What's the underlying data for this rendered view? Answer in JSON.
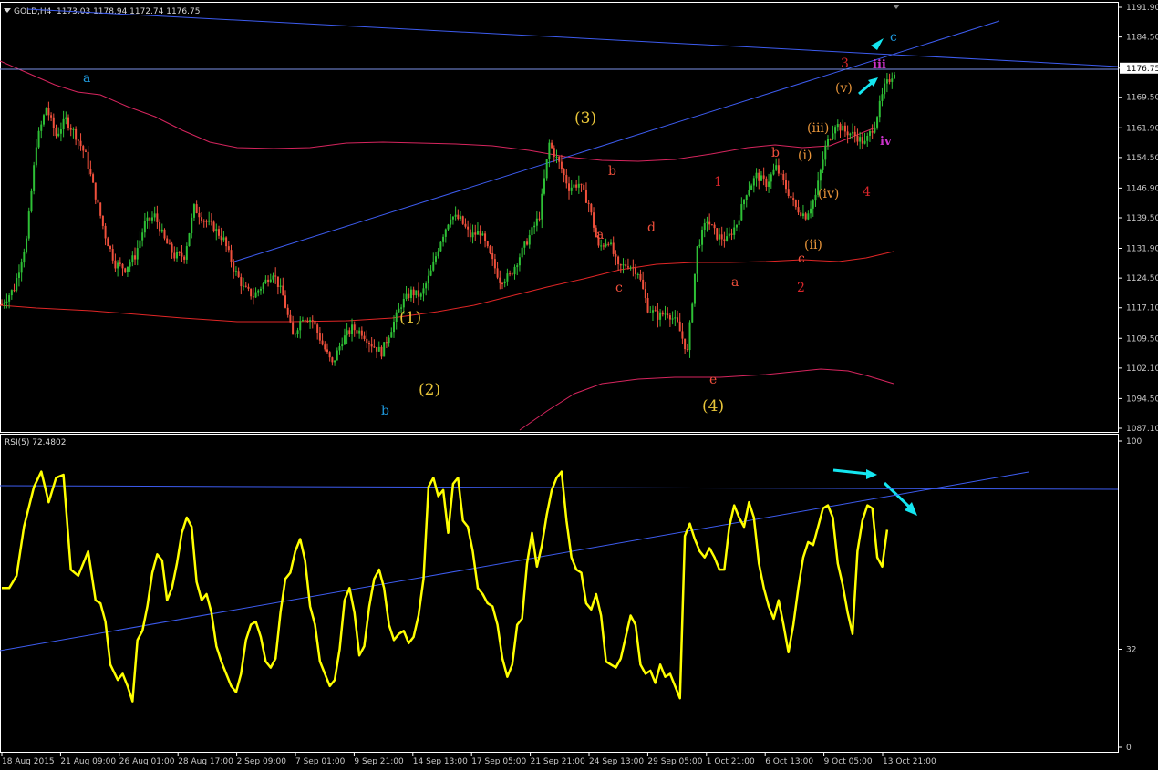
{
  "symbol_header": {
    "symbol": "GOLD,H4",
    "ohlc": "1173.03 1178.94 1172.74 1176.75"
  },
  "rsi_header": "RSI(5) 72.4802",
  "colors": {
    "background": "#000000",
    "frame": "#ffffff",
    "bull": "#2ec036",
    "bear": "#f0503c",
    "ma": "#e02626",
    "band": "#d6255e",
    "trendline": "#3d5cf0",
    "price_line": "#7d92e8",
    "rsi_line": "#ffff00",
    "arrow": "#14e6f0"
  },
  "chart_data": [
    {
      "type": "candlestick",
      "title": "GOLD,H4",
      "y_ticks": [
        "1191.90",
        "1184.50",
        "1176.75",
        "1169.50",
        "1161.90",
        "1154.50",
        "1146.90",
        "1139.50",
        "1131.90",
        "1124.50",
        "1117.10",
        "1109.50",
        "1102.10",
        "1094.50",
        "1087.10"
      ],
      "current_price": "1176.75",
      "ylim": [
        1087.1,
        1191.9
      ],
      "x_ticks": [
        "18 Aug 2015",
        "21 Aug 09:00",
        "26 Aug 01:00",
        "28 Aug 17:00",
        "2 Sep 09:00",
        "7 Sep 01:00",
        "9 Sep 21:00",
        "14 Sep 13:00",
        "17 Sep 05:00",
        "21 Sep 21:00",
        "24 Sep 13:00",
        "29 Sep 05:00",
        "1 Oct 21:00",
        "6 Oct 13:00",
        "9 Oct 05:00",
        "13 Oct 21:00"
      ],
      "price_path": [
        [
          0,
          1118
        ],
        [
          5,
          1122
        ],
        [
          10,
          1134
        ],
        [
          14,
          1158
        ],
        [
          18,
          1167
        ],
        [
          22,
          1160
        ],
        [
          26,
          1164
        ],
        [
          30,
          1160
        ],
        [
          34,
          1155
        ],
        [
          38,
          1145
        ],
        [
          42,
          1135
        ],
        [
          46,
          1128
        ],
        [
          50,
          1127
        ],
        [
          54,
          1130
        ],
        [
          58,
          1138
        ],
        [
          62,
          1140
        ],
        [
          66,
          1134
        ],
        [
          70,
          1130
        ],
        [
          74,
          1130
        ],
        [
          78,
          1142
        ],
        [
          82,
          1139
        ],
        [
          86,
          1137
        ],
        [
          90,
          1134
        ],
        [
          94,
          1127
        ],
        [
          98,
          1122
        ],
        [
          102,
          1120
        ],
        [
          106,
          1123
        ],
        [
          110,
          1126
        ],
        [
          114,
          1120
        ],
        [
          118,
          1110
        ],
        [
          122,
          1115
        ],
        [
          126,
          1114
        ],
        [
          130,
          1108
        ],
        [
          134,
          1103
        ],
        [
          138,
          1109
        ],
        [
          142,
          1112
        ],
        [
          146,
          1111
        ],
        [
          150,
          1108
        ],
        [
          154,
          1106
        ],
        [
          158,
          1112
        ],
        [
          162,
          1118
        ],
        [
          166,
          1121
        ],
        [
          170,
          1120
        ],
        [
          174,
          1126
        ],
        [
          178,
          1134
        ],
        [
          182,
          1140
        ],
        [
          186,
          1139
        ],
        [
          190,
          1135
        ],
        [
          194,
          1136
        ],
        [
          198,
          1130
        ],
        [
          202,
          1124
        ],
        [
          206,
          1125
        ],
        [
          210,
          1130
        ],
        [
          214,
          1135
        ],
        [
          218,
          1140
        ],
        [
          222,
          1158
        ],
        [
          226,
          1153
        ],
        [
          230,
          1147
        ],
        [
          234,
          1148
        ],
        [
          238,
          1143
        ],
        [
          242,
          1132
        ],
        [
          246,
          1134
        ],
        [
          250,
          1127
        ],
        [
          254,
          1128
        ],
        [
          258,
          1126
        ],
        [
          262,
          1117
        ],
        [
          266,
          1115
        ],
        [
          270,
          1116
        ],
        [
          274,
          1113
        ],
        [
          278,
          1106
        ],
        [
          282,
          1132
        ],
        [
          286,
          1139
        ],
        [
          290,
          1135
        ],
        [
          294,
          1134
        ],
        [
          298,
          1138
        ],
        [
          302,
          1146
        ],
        [
          306,
          1150
        ],
        [
          310,
          1148
        ],
        [
          314,
          1152
        ],
        [
          318,
          1147
        ],
        [
          322,
          1142
        ],
        [
          326,
          1140
        ],
        [
          330,
          1145
        ],
        [
          334,
          1157
        ],
        [
          338,
          1163
        ],
        [
          342,
          1161
        ],
        [
          346,
          1160
        ],
        [
          350,
          1158
        ],
        [
          354,
          1163
        ],
        [
          358,
          1172
        ],
        [
          362,
          1176
        ]
      ],
      "indicators": [
        "Moving average",
        "Envelope upper band",
        "Envelope lower band"
      ],
      "horizontal_line_price": 1176.75,
      "trendlines": [
        "upper resistance line",
        "rising support-to-resistance line"
      ],
      "wave_labels": [
        {
          "text": "a",
          "color": "#1e9be0"
        },
        {
          "text": "b",
          "color": "#1e9be0"
        },
        {
          "text": "c",
          "color": "#1e9be0"
        },
        {
          "text": "(1)",
          "color": "#e8c53a"
        },
        {
          "text": "(2)",
          "color": "#e8c53a"
        },
        {
          "text": "(3)",
          "color": "#e8c53a"
        },
        {
          "text": "(4)",
          "color": "#e8c53a"
        },
        {
          "text": "b",
          "color": "#f0503c"
        },
        {
          "text": "a",
          "color": "#f0503c"
        },
        {
          "text": "c",
          "color": "#f0503c"
        },
        {
          "text": "d",
          "color": "#f0503c"
        },
        {
          "text": "e",
          "color": "#f0503c"
        },
        {
          "text": "1",
          "color": "#d8262b"
        },
        {
          "text": "a",
          "color": "#f0503c"
        },
        {
          "text": "b",
          "color": "#f0503c"
        },
        {
          "text": "c",
          "color": "#f0503c"
        },
        {
          "text": "2",
          "color": "#d8262b"
        },
        {
          "text": "3",
          "color": "#d8262b"
        },
        {
          "text": "4",
          "color": "#d8262b"
        },
        {
          "text": "(i)",
          "color": "#e8953a"
        },
        {
          "text": "(ii)",
          "color": "#e8953a"
        },
        {
          "text": "(iii)",
          "color": "#e8953a"
        },
        {
          "text": "(iv)",
          "color": "#e8953a"
        },
        {
          "text": "(v)",
          "color": "#e8953a"
        },
        {
          "text": "iii",
          "color": "#cc33cc"
        },
        {
          "text": "iv",
          "color": "#cc33cc"
        }
      ]
    },
    {
      "type": "line",
      "title": "RSI(5) 72.4802",
      "ylim": [
        0,
        100
      ],
      "y_ticks": [
        "100",
        "32",
        "0"
      ],
      "series": [
        {
          "name": "RSI(5)",
          "values": [
            [
              0,
              52
            ],
            [
              3,
              52
            ],
            [
              6,
              56
            ],
            [
              9,
              72
            ],
            [
              13,
              85
            ],
            [
              16,
              90
            ],
            [
              19,
              80
            ],
            [
              22,
              88
            ],
            [
              25,
              89
            ],
            [
              28,
              58
            ],
            [
              31,
              56
            ],
            [
              35,
              64
            ],
            [
              38,
              48
            ],
            [
              40,
              47
            ],
            [
              42,
              41
            ],
            [
              44,
              27
            ],
            [
              47,
              22
            ],
            [
              49,
              24
            ],
            [
              51,
              20
            ],
            [
              53,
              15
            ],
            [
              55,
              35
            ],
            [
              57,
              38
            ],
            [
              59,
              46
            ],
            [
              61,
              57
            ],
            [
              63,
              63
            ],
            [
              65,
              61
            ],
            [
              67,
              48
            ],
            [
              69,
              52
            ],
            [
              71,
              60
            ],
            [
              73,
              70
            ],
            [
              75,
              75
            ],
            [
              77,
              72
            ],
            [
              79,
              54
            ],
            [
              81,
              48
            ],
            [
              83,
              50
            ],
            [
              85,
              44
            ],
            [
              87,
              33
            ],
            [
              89,
              28
            ],
            [
              91,
              24
            ],
            [
              93,
              20
            ],
            [
              95,
              18
            ],
            [
              97,
              24
            ],
            [
              99,
              35
            ],
            [
              101,
              40
            ],
            [
              103,
              41
            ],
            [
              105,
              36
            ],
            [
              107,
              28
            ],
            [
              109,
              26
            ],
            [
              111,
              29
            ],
            [
              113,
              44
            ],
            [
              115,
              55
            ],
            [
              117,
              57
            ],
            [
              119,
              64
            ],
            [
              121,
              68
            ],
            [
              123,
              61
            ],
            [
              125,
              46
            ],
            [
              127,
              40
            ],
            [
              129,
              28
            ],
            [
              131,
              24
            ],
            [
              133,
              20
            ],
            [
              135,
              22
            ],
            [
              137,
              32
            ],
            [
              139,
              48
            ],
            [
              141,
              52
            ],
            [
              143,
              44
            ],
            [
              145,
              30
            ],
            [
              147,
              33
            ],
            [
              149,
              46
            ],
            [
              151,
              55
            ],
            [
              153,
              58
            ],
            [
              155,
              52
            ],
            [
              157,
              40
            ],
            [
              159,
              35
            ],
            [
              161,
              37
            ],
            [
              163,
              38
            ],
            [
              165,
              34
            ],
            [
              167,
              36
            ],
            [
              169,
              43
            ],
            [
              171,
              55
            ],
            [
              173,
              85
            ],
            [
              175,
              88
            ],
            [
              177,
              82
            ],
            [
              179,
              84
            ],
            [
              181,
              70
            ],
            [
              183,
              86
            ],
            [
              185,
              88
            ],
            [
              187,
              74
            ],
            [
              189,
              72
            ],
            [
              191,
              64
            ],
            [
              193,
              52
            ],
            [
              195,
              50
            ],
            [
              197,
              47
            ],
            [
              199,
              46
            ],
            [
              201,
              40
            ],
            [
              203,
              29
            ],
            [
              205,
              23
            ],
            [
              207,
              27
            ],
            [
              209,
              40
            ],
            [
              211,
              42
            ],
            [
              213,
              60
            ],
            [
              215,
              70
            ],
            [
              217,
              59
            ],
            [
              219,
              66
            ],
            [
              221,
              76
            ],
            [
              223,
              84
            ],
            [
              225,
              88
            ],
            [
              227,
              90
            ],
            [
              229,
              74
            ],
            [
              231,
              62
            ],
            [
              233,
              58
            ],
            [
              235,
              57
            ],
            [
              237,
              47
            ],
            [
              239,
              45
            ],
            [
              241,
              50
            ],
            [
              243,
              43
            ],
            [
              245,
              28
            ],
            [
              247,
              27
            ],
            [
              249,
              26
            ],
            [
              251,
              29
            ],
            [
              253,
              36
            ],
            [
              255,
              43
            ],
            [
              257,
              40
            ],
            [
              259,
              27
            ],
            [
              261,
              24
            ],
            [
              263,
              25
            ],
            [
              265,
              21
            ],
            [
              267,
              27
            ],
            [
              269,
              23
            ],
            [
              271,
              24
            ],
            [
              273,
              20
            ],
            [
              275,
              16
            ],
            [
              277,
              69
            ],
            [
              279,
              73
            ],
            [
              281,
              68
            ],
            [
              283,
              64
            ],
            [
              285,
              62
            ],
            [
              287,
              65
            ],
            [
              289,
              62
            ],
            [
              291,
              58
            ],
            [
              293,
              58
            ],
            [
              295,
              72
            ],
            [
              297,
              79
            ],
            [
              299,
              75
            ],
            [
              301,
              72
            ],
            [
              303,
              80
            ],
            [
              305,
              75
            ],
            [
              307,
              60
            ],
            [
              309,
              52
            ],
            [
              311,
              46
            ],
            [
              313,
              42
            ],
            [
              315,
              48
            ],
            [
              317,
              40
            ],
            [
              319,
              31
            ],
            [
              321,
              40
            ],
            [
              323,
              52
            ],
            [
              325,
              62
            ],
            [
              327,
              67
            ],
            [
              329,
              66
            ],
            [
              331,
              72
            ],
            [
              333,
              78
            ],
            [
              335,
              79
            ],
            [
              337,
              75
            ],
            [
              339,
              60
            ],
            [
              341,
              53
            ],
            [
              343,
              44
            ],
            [
              345,
              37
            ],
            [
              347,
              64
            ],
            [
              349,
              74
            ],
            [
              351,
              79
            ],
            [
              353,
              78
            ],
            [
              355,
              62
            ],
            [
              357,
              59
            ],
            [
              359,
              71
            ]
          ]
        }
      ],
      "trendlines": [
        "horizontal resistance",
        "rising support line"
      ]
    }
  ]
}
